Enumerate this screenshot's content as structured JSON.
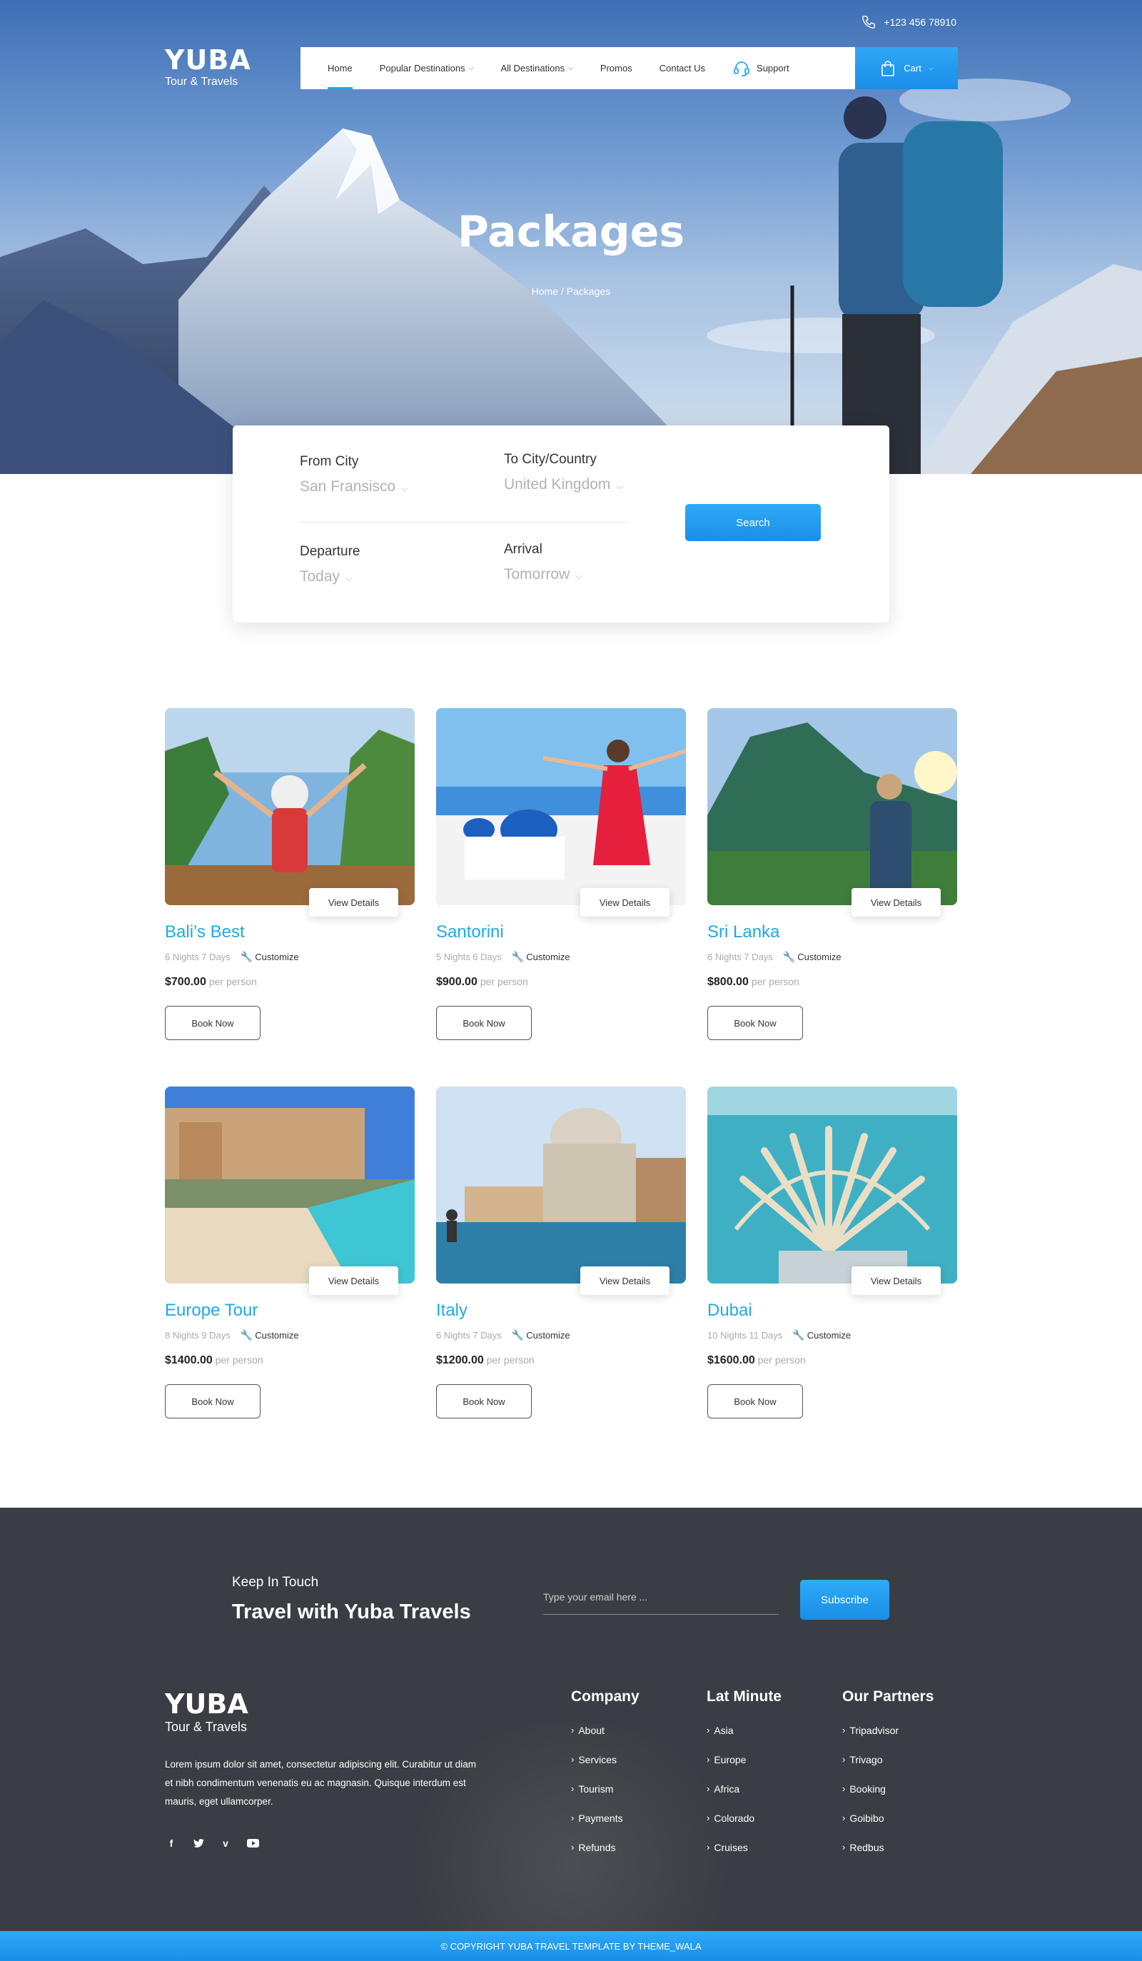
{
  "topbar": {
    "phone": "+123 456 78910",
    "phone_icon": "phone-icon"
  },
  "brand": {
    "name": "YUBA",
    "tagline": "Tour & Travels"
  },
  "nav": {
    "items": [
      {
        "label": "Home",
        "active": true,
        "dropdown": false
      },
      {
        "label": "Popular Destinations",
        "active": false,
        "dropdown": true
      },
      {
        "label": "All Destinations",
        "active": false,
        "dropdown": true
      },
      {
        "label": "Promos",
        "active": false,
        "dropdown": false
      },
      {
        "label": "Contact Us",
        "active": false,
        "dropdown": false
      }
    ],
    "support_label": "Support",
    "support_icon": "headset-icon",
    "cart_label": "Cart",
    "cart_icon": "shopping-bag-icon"
  },
  "hero": {
    "title": "Packages",
    "breadcrumb": "Home / Packages"
  },
  "search": {
    "from_label": "From City",
    "from_value": "San Fransisco",
    "to_label": "To City/Country",
    "to_value": "United Kingdom",
    "departure_label": "Departure",
    "departure_value": "Today",
    "arrival_label": "Arrival",
    "arrival_value": "Tomorrow",
    "button": "Search"
  },
  "packages": [
    {
      "title": "Bali’s Best",
      "duration": "6 Nights 7 Days",
      "customize": "Customize",
      "price": "$700.00",
      "per": "per person",
      "view": "View Details",
      "book": "Book Now"
    },
    {
      "title": "Santorini",
      "duration": "5 Nights 6 Days",
      "customize": "Customize",
      "price": "$900.00",
      "per": "per person",
      "view": "View Details",
      "book": "Book Now"
    },
    {
      "title": "Sri Lanka",
      "duration": "6 Nights 7 Days",
      "customize": "Customize",
      "price": "$800.00",
      "per": "per person",
      "view": "View Details",
      "book": "Book Now"
    },
    {
      "title": "Europe Tour",
      "duration": "8 Nights 9 Days",
      "customize": "Customize",
      "price": "$1400.00",
      "per": "per person",
      "view": "View Details",
      "book": "Book Now"
    },
    {
      "title": "Italy",
      "duration": "6 Nights 7 Days",
      "customize": "Customize",
      "price": "$1200.00",
      "per": "per person",
      "view": "View Details",
      "book": "Book Now"
    },
    {
      "title": "Dubai",
      "duration": "10 Nights 11 Days",
      "customize": "Customize",
      "price": "$1600.00",
      "per": "per person",
      "view": "View Details",
      "book": "Book Now"
    }
  ],
  "newsletter": {
    "kicker": "Keep In Touch",
    "headline": "Travel with Yuba Travels",
    "placeholder": "Type your email here ...",
    "button": "Subscribe"
  },
  "footer": {
    "brand": "YUBA",
    "tagline": "Tour & Travels",
    "description": "Lorem ipsum dolor sit amet, consectetur adipiscing elit. Curabitur ut diam et nibh condimentum venenatis eu ac magnasin. Quisque interdum est mauris, eget ullamcorper.",
    "social": [
      "facebook-icon",
      "twitter-icon",
      "vimeo-icon",
      "youtube-icon"
    ],
    "columns": [
      {
        "title": "Company",
        "links": [
          "About",
          "Services",
          "Tourism",
          "Payments",
          "Refunds"
        ]
      },
      {
        "title": "Lat Minute",
        "links": [
          "Asia",
          "Europe",
          "Africa",
          "Colorado",
          "Cruises"
        ]
      },
      {
        "title": "Our Partners",
        "links": [
          "Tripadvisor",
          "Trivago",
          "Booking",
          "Goibibo",
          "Redbus"
        ]
      }
    ],
    "copyright": "© COPYRIGHT YUBA TRAVEL TEMPLATE BY THEME_WALA"
  },
  "colors": {
    "accent": "#1eaae7",
    "button": "#1a8ee8",
    "footer_bg": "#3a3d43"
  }
}
